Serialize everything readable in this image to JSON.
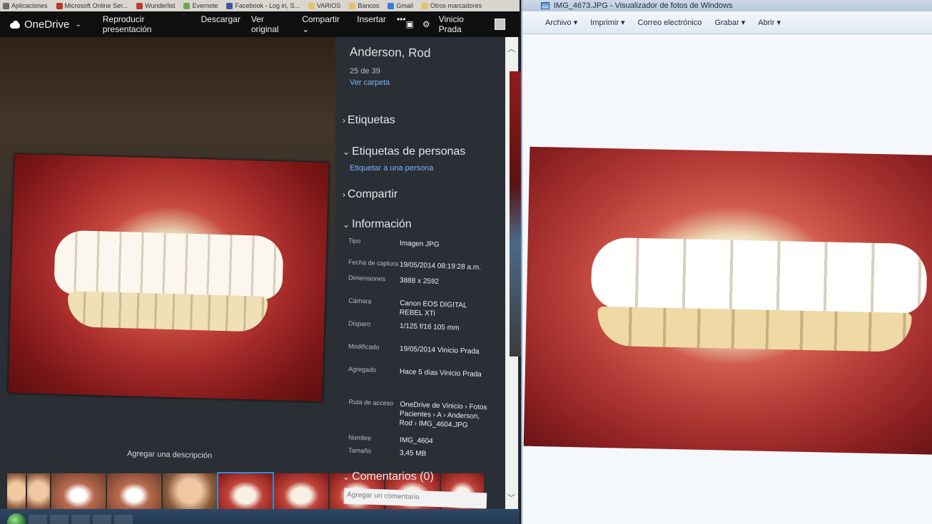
{
  "bookmarks": [
    {
      "label": "Aplicaciones",
      "icon": "apps-icon",
      "color": "#6a6a6a"
    },
    {
      "label": "Microsoft Online Ser...",
      "icon": "office-icon",
      "color": "#b53a1e"
    },
    {
      "label": "Wunderlist",
      "icon": "wunderlist-icon",
      "color": "#c0392b"
    },
    {
      "label": "Evernote",
      "icon": "evernote-icon",
      "color": "#6aa84f"
    },
    {
      "label": "Facebook - Log in, S...",
      "icon": "facebook-icon",
      "color": "#3b5998"
    },
    {
      "label": "VARIOS",
      "icon": "folder-icon",
      "color": "#e5c26a"
    },
    {
      "label": "Bancos",
      "icon": "folder-icon",
      "color": "#e5c26a"
    },
    {
      "label": "Gmail",
      "icon": "gmail-icon",
      "color": "#3a7bd5"
    },
    {
      "label": "Otros marcadores",
      "icon": "folder-icon",
      "color": "#e5c26a"
    }
  ],
  "onedrive": {
    "logo": "OneDrive",
    "menu": [
      "Reproducir presentación",
      "Descargar",
      "Ver original",
      "Compartir",
      "Insertar",
      "•••"
    ],
    "user": "Vinicio Prada",
    "description_prompt": "Agregar una descripción"
  },
  "info": {
    "title": "Anderson, Rod",
    "counter": "25 de 39",
    "view_folder": "Ver carpeta",
    "sections": {
      "tags": "Etiquetas",
      "people_tags": "Etiquetas de personas",
      "tag_person": "Etiquetar a una persona",
      "share": "Compartir",
      "information": "Información",
      "comments": "Comentarios (0)",
      "comment_placeholder": "Agregar un comentario"
    },
    "details": [
      {
        "key": "Tipo",
        "value": "Imagen JPG"
      },
      {
        "key": "Fecha de captura",
        "value": "19/05/2014 08:19:28 a.m."
      },
      {
        "key": "Dimensiones",
        "value": "3888 x 2592"
      },
      {
        "key": "Cámara",
        "value": "Canon EOS DIGITAL REBEL XTi"
      },
      {
        "key": "Disparo",
        "value": "1/125 f/16 105 mm"
      },
      {
        "key": "Modificado",
        "value": "19/05/2014 Vinicio Prada"
      },
      {
        "key": "Agregado",
        "value": "Hace 5 días Vinicio Prada"
      },
      {
        "key": "Ruta de acceso",
        "value": "OneDrive de Vinicio › Fotos Pacientes › A › Anderson, Rod › IMG_4604.JPG"
      },
      {
        "key": "Nombre",
        "value": "IMG_4604"
      },
      {
        "key": "Tamaño",
        "value": "3,45 MB"
      }
    ]
  },
  "viewer": {
    "title": "IMG_4673.JPG - Visualizador de fotos de Windows",
    "menu": [
      "Archivo",
      "Imprimir",
      "Correo electrónico",
      "Grabar",
      "Abrir"
    ]
  }
}
